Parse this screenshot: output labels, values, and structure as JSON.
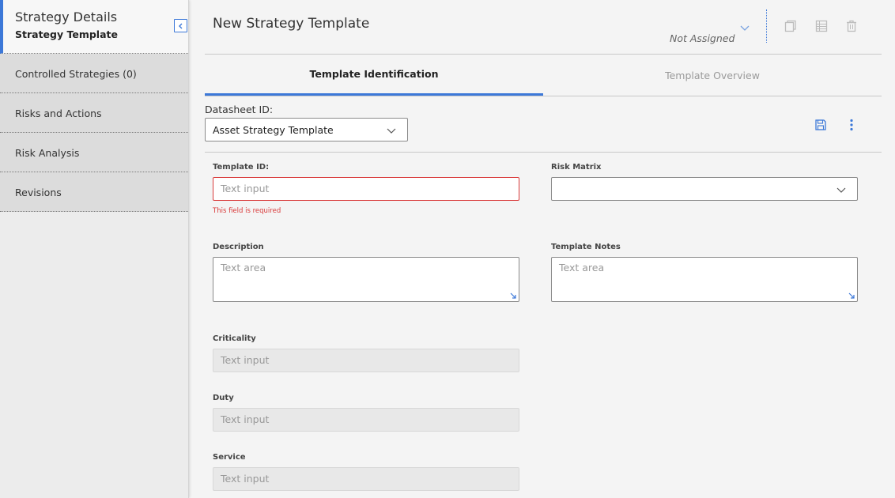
{
  "sidebar": {
    "title": "Strategy Details",
    "subtitle": "Strategy Template",
    "items": [
      {
        "label": "Controlled Strategies (0)"
      },
      {
        "label": "Risks and Actions"
      },
      {
        "label": "Risk Analysis"
      },
      {
        "label": "Revisions"
      }
    ]
  },
  "header": {
    "title": "New Strategy Template",
    "state": "Not Assigned"
  },
  "tabs": [
    {
      "label": "Template Identification",
      "active": true
    },
    {
      "label": "Template Overview",
      "active": false
    }
  ],
  "datasheet": {
    "label": "Datasheet ID:",
    "value": "Asset Strategy Template"
  },
  "form": {
    "template_id": {
      "label": "Template ID:",
      "placeholder": "Text input",
      "error": "This field is required"
    },
    "risk_matrix": {
      "label": "Risk Matrix",
      "value": ""
    },
    "description": {
      "label": "Description",
      "placeholder": "Text area"
    },
    "template_notes": {
      "label": "Template Notes",
      "placeholder": "Text area"
    },
    "criticality": {
      "label": "Criticality",
      "placeholder": "Text input"
    },
    "duty": {
      "label": "Duty",
      "placeholder": "Text input"
    },
    "service": {
      "label": "Service",
      "placeholder": "Text input"
    }
  },
  "icons": {
    "collapse": "collapse-left-icon",
    "state": "chevron-down-icon",
    "copy": "copy-icon",
    "grid": "grid-icon",
    "trash": "trash-icon",
    "save": "save-icon",
    "more": "more-vertical-icon"
  },
  "colors": {
    "accent": "#3c78d8",
    "error": "#d93a3a"
  }
}
